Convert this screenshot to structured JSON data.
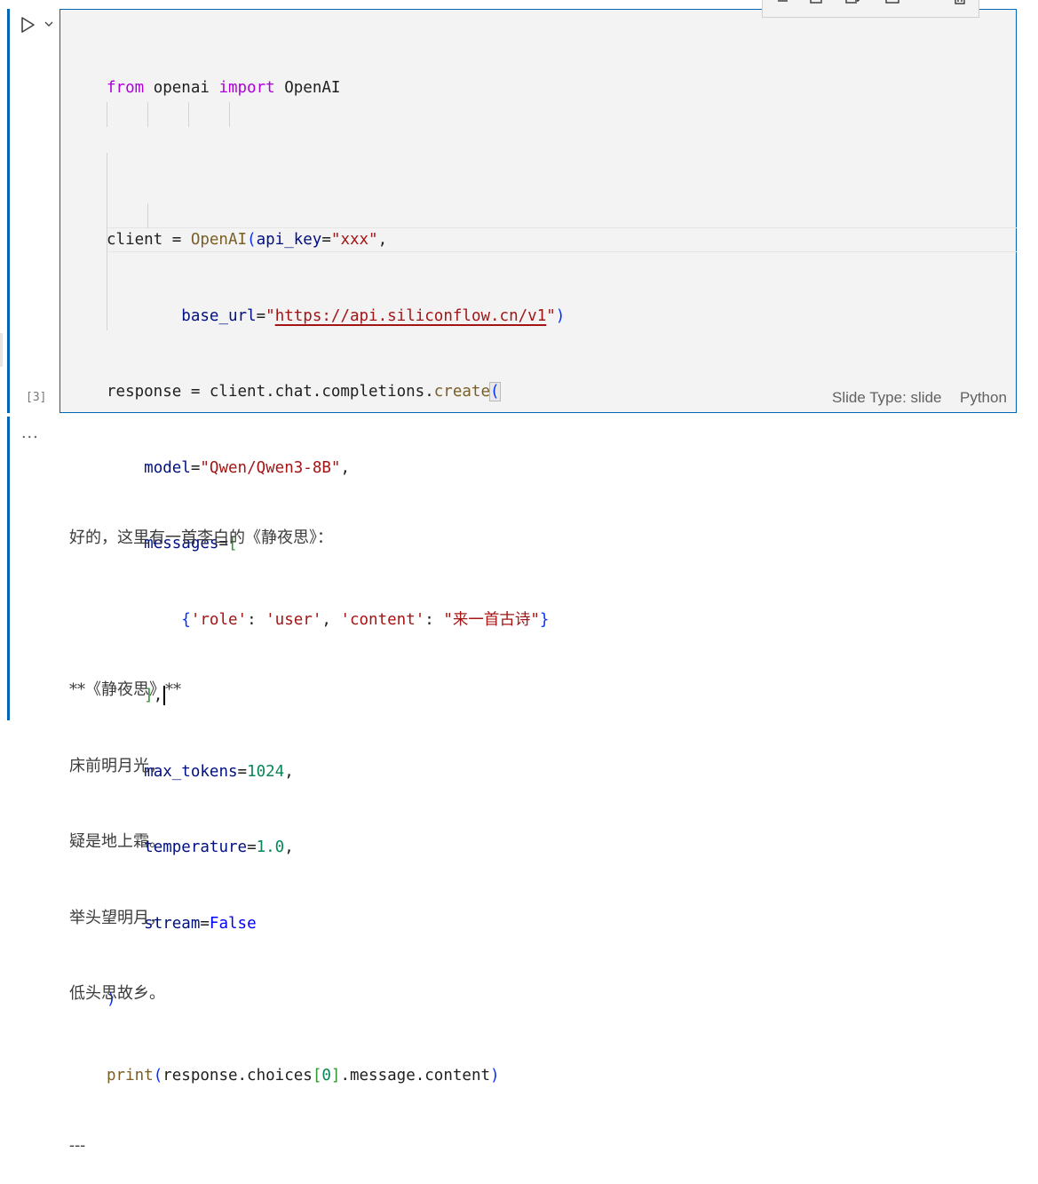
{
  "cell": {
    "execution_count": "[3]",
    "slide_type_label": "Slide Type: slide",
    "language": "Python",
    "code": {
      "l1_from": "from",
      "l1_mod": " openai ",
      "l1_import": "import",
      "l1_name": " OpenAI",
      "l3_a": "client = ",
      "l3_fn": "OpenAI",
      "l3_par": "(",
      "l3_prm": "api_key",
      "l3_eq": "=",
      "l3_str": "\"xxx\"",
      "l3_comma": ",",
      "l4_indent": "        ",
      "l4_prm": "base_url",
      "l4_eq": "=",
      "l4_q1": "\"",
      "l4_url": "https://api.siliconflow.cn/v1",
      "l4_q2": "\"",
      "l4_par": ")",
      "l5_a": "response = client.chat.completions.",
      "l5_fn": "create",
      "l5_par": "(",
      "l6_prm": "model",
      "l6_eq": "=",
      "l6_str": "\"Qwen/Qwen3-8B\"",
      "l6_comma": ",",
      "l7_prm": "messages",
      "l7_eq": "=",
      "l7_brk": "[",
      "l8_open": "{",
      "l8_s1": "'role'",
      "l8_c1": ": ",
      "l8_s2": "'user'",
      "l8_c2": ", ",
      "l8_s3": "'content'",
      "l8_c3": ": ",
      "l8_s4": "\"来一首古诗\"",
      "l8_close": "}",
      "l9_brk": "]",
      "l9_comma": ",",
      "l10_prm": "max_tokens",
      "l10_eq": "=",
      "l10_num": "1024",
      "l10_comma": ",",
      "l11_prm": "temperature",
      "l11_eq": "=",
      "l11_num": "1.0",
      "l11_comma": ",",
      "l12_prm": "stream",
      "l12_eq": "=",
      "l12_bool": "False",
      "l13_par": ")",
      "l14_fn": "print",
      "l14_par1": "(",
      "l14_a": "response.choices",
      "l14_brk1": "[",
      "l14_num": "0",
      "l14_brk2": "]",
      "l14_b": ".message.content",
      "l14_par2": ")"
    }
  },
  "output": {
    "ellipsis": "...",
    "lines": [
      "好的，这里有一首李白的《静夜思》：",
      "",
      "**《静夜思》**",
      "床前明月光，",
      "疑是地上霜。",
      "举头望明月，",
      "低头思故乡。",
      "",
      "---"
    ]
  },
  "icons": {
    "run": "play-icon",
    "run_menu": "chevron-down-icon",
    "toolbar": [
      "list-icon",
      "split-above-icon",
      "split-below-icon",
      "cell-layout-icon",
      "more-icon",
      "delete-icon"
    ]
  },
  "colors": {
    "accent": "#0065b3",
    "editor_bg": "#f3f3f3",
    "keyword": "#af00db",
    "function": "#795e26",
    "string": "#a31515",
    "number": "#098658",
    "parameter": "#001080"
  }
}
